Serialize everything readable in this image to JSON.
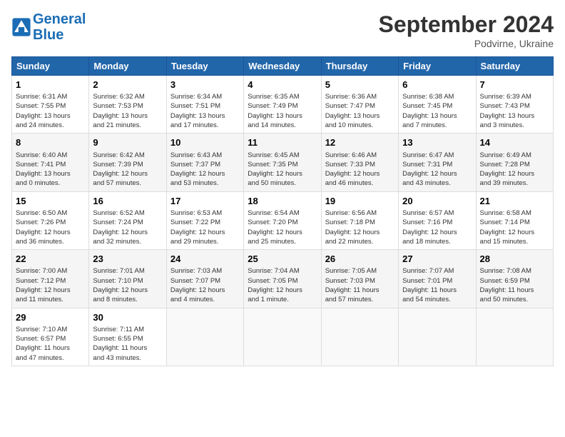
{
  "header": {
    "logo_line1": "General",
    "logo_line2": "Blue",
    "month_title": "September 2024",
    "location": "Podvirne, Ukraine"
  },
  "days_of_week": [
    "Sunday",
    "Monday",
    "Tuesday",
    "Wednesday",
    "Thursday",
    "Friday",
    "Saturday"
  ],
  "weeks": [
    [
      {
        "day": "1",
        "info": "Sunrise: 6:31 AM\nSunset: 7:55 PM\nDaylight: 13 hours\nand 24 minutes."
      },
      {
        "day": "2",
        "info": "Sunrise: 6:32 AM\nSunset: 7:53 PM\nDaylight: 13 hours\nand 21 minutes."
      },
      {
        "day": "3",
        "info": "Sunrise: 6:34 AM\nSunset: 7:51 PM\nDaylight: 13 hours\nand 17 minutes."
      },
      {
        "day": "4",
        "info": "Sunrise: 6:35 AM\nSunset: 7:49 PM\nDaylight: 13 hours\nand 14 minutes."
      },
      {
        "day": "5",
        "info": "Sunrise: 6:36 AM\nSunset: 7:47 PM\nDaylight: 13 hours\nand 10 minutes."
      },
      {
        "day": "6",
        "info": "Sunrise: 6:38 AM\nSunset: 7:45 PM\nDaylight: 13 hours\nand 7 minutes."
      },
      {
        "day": "7",
        "info": "Sunrise: 6:39 AM\nSunset: 7:43 PM\nDaylight: 13 hours\nand 3 minutes."
      }
    ],
    [
      {
        "day": "8",
        "info": "Sunrise: 6:40 AM\nSunset: 7:41 PM\nDaylight: 13 hours\nand 0 minutes."
      },
      {
        "day": "9",
        "info": "Sunrise: 6:42 AM\nSunset: 7:39 PM\nDaylight: 12 hours\nand 57 minutes."
      },
      {
        "day": "10",
        "info": "Sunrise: 6:43 AM\nSunset: 7:37 PM\nDaylight: 12 hours\nand 53 minutes."
      },
      {
        "day": "11",
        "info": "Sunrise: 6:45 AM\nSunset: 7:35 PM\nDaylight: 12 hours\nand 50 minutes."
      },
      {
        "day": "12",
        "info": "Sunrise: 6:46 AM\nSunset: 7:33 PM\nDaylight: 12 hours\nand 46 minutes."
      },
      {
        "day": "13",
        "info": "Sunrise: 6:47 AM\nSunset: 7:31 PM\nDaylight: 12 hours\nand 43 minutes."
      },
      {
        "day": "14",
        "info": "Sunrise: 6:49 AM\nSunset: 7:28 PM\nDaylight: 12 hours\nand 39 minutes."
      }
    ],
    [
      {
        "day": "15",
        "info": "Sunrise: 6:50 AM\nSunset: 7:26 PM\nDaylight: 12 hours\nand 36 minutes."
      },
      {
        "day": "16",
        "info": "Sunrise: 6:52 AM\nSunset: 7:24 PM\nDaylight: 12 hours\nand 32 minutes."
      },
      {
        "day": "17",
        "info": "Sunrise: 6:53 AM\nSunset: 7:22 PM\nDaylight: 12 hours\nand 29 minutes."
      },
      {
        "day": "18",
        "info": "Sunrise: 6:54 AM\nSunset: 7:20 PM\nDaylight: 12 hours\nand 25 minutes."
      },
      {
        "day": "19",
        "info": "Sunrise: 6:56 AM\nSunset: 7:18 PM\nDaylight: 12 hours\nand 22 minutes."
      },
      {
        "day": "20",
        "info": "Sunrise: 6:57 AM\nSunset: 7:16 PM\nDaylight: 12 hours\nand 18 minutes."
      },
      {
        "day": "21",
        "info": "Sunrise: 6:58 AM\nSunset: 7:14 PM\nDaylight: 12 hours\nand 15 minutes."
      }
    ],
    [
      {
        "day": "22",
        "info": "Sunrise: 7:00 AM\nSunset: 7:12 PM\nDaylight: 12 hours\nand 11 minutes."
      },
      {
        "day": "23",
        "info": "Sunrise: 7:01 AM\nSunset: 7:10 PM\nDaylight: 12 hours\nand 8 minutes."
      },
      {
        "day": "24",
        "info": "Sunrise: 7:03 AM\nSunset: 7:07 PM\nDaylight: 12 hours\nand 4 minutes."
      },
      {
        "day": "25",
        "info": "Sunrise: 7:04 AM\nSunset: 7:05 PM\nDaylight: 12 hours\nand 1 minute."
      },
      {
        "day": "26",
        "info": "Sunrise: 7:05 AM\nSunset: 7:03 PM\nDaylight: 11 hours\nand 57 minutes."
      },
      {
        "day": "27",
        "info": "Sunrise: 7:07 AM\nSunset: 7:01 PM\nDaylight: 11 hours\nand 54 minutes."
      },
      {
        "day": "28",
        "info": "Sunrise: 7:08 AM\nSunset: 6:59 PM\nDaylight: 11 hours\nand 50 minutes."
      }
    ],
    [
      {
        "day": "29",
        "info": "Sunrise: 7:10 AM\nSunset: 6:57 PM\nDaylight: 11 hours\nand 47 minutes."
      },
      {
        "day": "30",
        "info": "Sunrise: 7:11 AM\nSunset: 6:55 PM\nDaylight: 11 hours\nand 43 minutes."
      },
      {
        "day": "",
        "info": ""
      },
      {
        "day": "",
        "info": ""
      },
      {
        "day": "",
        "info": ""
      },
      {
        "day": "",
        "info": ""
      },
      {
        "day": "",
        "info": ""
      }
    ]
  ]
}
